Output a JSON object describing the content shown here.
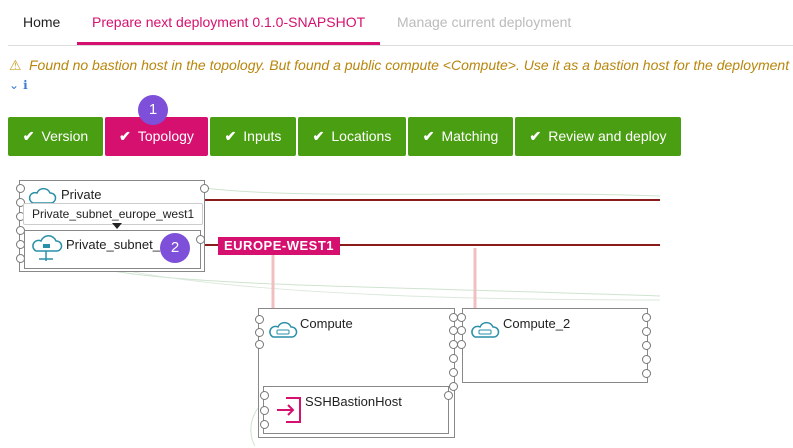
{
  "tabs": {
    "home": "Home",
    "prepare": "Prepare next deployment 0.1.0-SNAPSHOT",
    "manage": "Manage current deployment"
  },
  "warning": {
    "text": "Found no bastion host in the topology. But found a public compute <Compute>. Use it as a bastion host for the deployment",
    "icon": "warning-triangle-icon"
  },
  "steps": [
    {
      "label": "Version",
      "status": "done"
    },
    {
      "label": "Topology",
      "status": "current"
    },
    {
      "label": "Inputs",
      "status": "done"
    },
    {
      "label": "Locations",
      "status": "done"
    },
    {
      "label": "Matching",
      "status": "done"
    },
    {
      "label": "Review and deploy",
      "status": "done"
    }
  ],
  "badges": {
    "first": "1",
    "second": "2"
  },
  "topology": {
    "private_network": "Private",
    "tooltip": "Private_subnet_europe_west1",
    "subnet_label": "Private_subnet_",
    "network_tag": "EUROPE-WEST1",
    "compute": "Compute",
    "compute2": "Compute_2",
    "bastion": "SSHBastionHost"
  },
  "colors": {
    "accent": "#d6106f",
    "success": "#4a9e12",
    "badge": "#7e4fd9",
    "warning_text": "#b8860b",
    "network_line": "#8b1a1a"
  }
}
